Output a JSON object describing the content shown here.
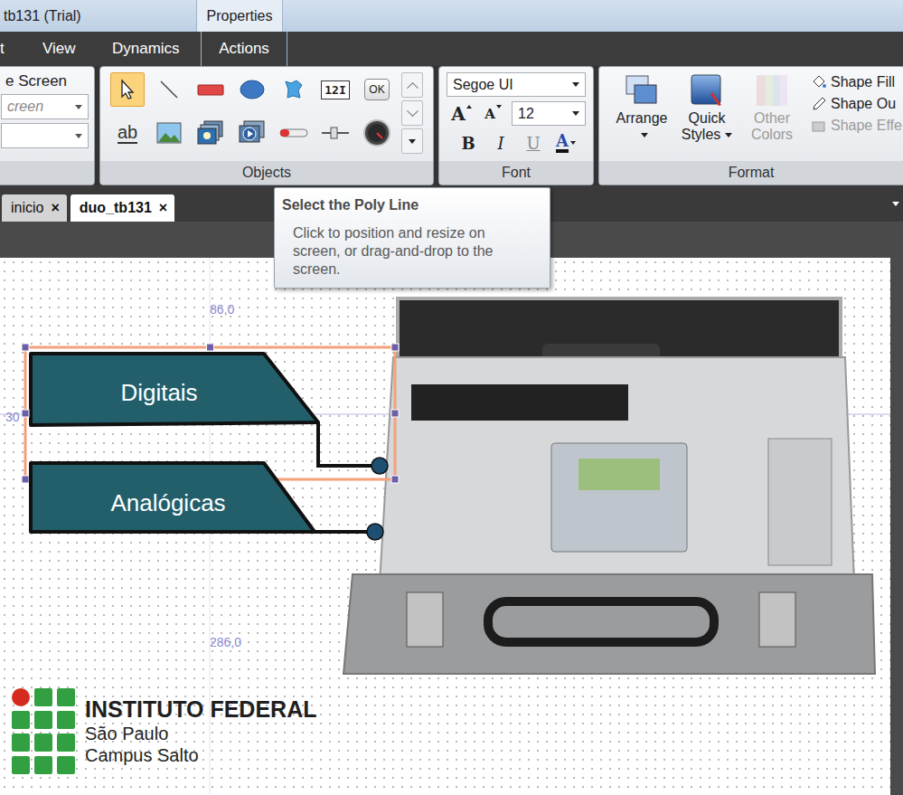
{
  "window": {
    "title": "tb131 (Trial)",
    "context_tab": "Properties"
  },
  "menu": [
    {
      "label": "t",
      "selected": false
    },
    {
      "label": "View",
      "selected": false
    },
    {
      "label": "Dynamics",
      "selected": false
    },
    {
      "label": "Actions",
      "selected": false
    }
  ],
  "screen_group": {
    "title": "e Screen",
    "fields": [
      {
        "value": "creen",
        "placeholder": true
      },
      {
        "value": "",
        "placeholder": false
      }
    ]
  },
  "objects_group": {
    "label": "Objects",
    "tools": [
      {
        "kind": "pointer",
        "text": "",
        "selected": true
      },
      {
        "kind": "line",
        "text": "",
        "selected": false
      },
      {
        "kind": "rect",
        "text": "",
        "selected": false
      },
      {
        "kind": "ellipse",
        "text": "",
        "selected": false
      },
      {
        "kind": "shape",
        "text": "",
        "selected": false
      },
      {
        "kind": "textbox",
        "text": "12I",
        "selected": false
      },
      {
        "kind": "button",
        "text": "OK",
        "selected": false
      },
      {
        "kind": "text",
        "text": "ab",
        "selected": false
      },
      {
        "kind": "image",
        "text": "",
        "selected": false
      },
      {
        "kind": "gallery",
        "text": "",
        "selected": false
      },
      {
        "kind": "video",
        "text": "",
        "selected": false
      },
      {
        "kind": "bar",
        "text": "",
        "selected": false
      },
      {
        "kind": "slider",
        "text": "",
        "selected": false
      },
      {
        "kind": "gauge",
        "text": "",
        "selected": false
      }
    ]
  },
  "font_group": {
    "label": "Font",
    "family": "Segoe UI",
    "size": "12",
    "grow": "A",
    "shrink": "A",
    "styles": [
      {
        "label": "B",
        "kind": "bold",
        "disabled": false
      },
      {
        "label": "I",
        "kind": "italic",
        "disabled": false
      },
      {
        "label": "U",
        "kind": "underline",
        "disabled": true
      },
      {
        "label": "A",
        "kind": "color",
        "disabled": false
      }
    ]
  },
  "format_group": {
    "label": "Format",
    "large": [
      {
        "label": "Arrange",
        "kind": "arrange",
        "dropdown": true,
        "disabled": false
      },
      {
        "label": "Quick Styles",
        "kind": "styles",
        "dropdown": true,
        "disabled": false
      },
      {
        "label": "Other Colors",
        "kind": "colors",
        "dropdown": false,
        "disabled": true
      }
    ],
    "small": [
      {
        "label": "Shape Fill",
        "kind": "fill",
        "disabled": false
      },
      {
        "label": "Shape Ou",
        "kind": "outline",
        "disabled": false
      },
      {
        "label": "Shape Effe",
        "kind": "effects",
        "disabled": true
      }
    ]
  },
  "doc_tabs": [
    {
      "label": "inicio",
      "close": "×",
      "selected": false
    },
    {
      "label": "duo_tb131",
      "close": "×",
      "selected": true
    }
  ],
  "tooltip": {
    "title": "Select the Poly Line",
    "body": "Click to position and resize on screen, or drag-and-drop to the screen."
  },
  "canvas": {
    "rulers": [
      "86,0",
      "30",
      "286,0"
    ],
    "shapes": [
      {
        "label": "Digitais",
        "selected": true
      },
      {
        "label": "Analógicas",
        "selected": false
      }
    ],
    "logo": {
      "lines": [
        "INSTITUTO FEDERAL",
        "São Paulo",
        "Campus Salto"
      ]
    }
  }
}
